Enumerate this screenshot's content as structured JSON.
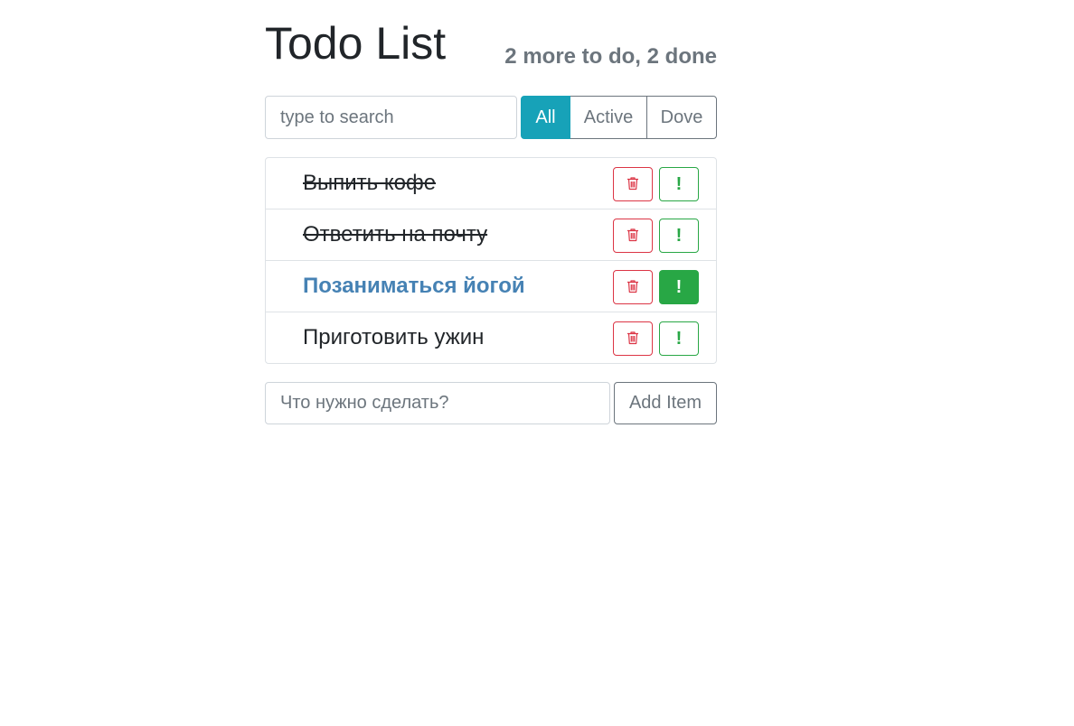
{
  "header": {
    "title": "Todo List",
    "status": "2 more to do, 2 done"
  },
  "search": {
    "placeholder": "type to search",
    "value": ""
  },
  "filters": [
    {
      "label": "All",
      "active": true
    },
    {
      "label": "Active",
      "active": false
    },
    {
      "label": "Dove",
      "active": false
    }
  ],
  "todos": [
    {
      "label": "Выпить кофе",
      "done": true,
      "important": false
    },
    {
      "label": "Ответить на почту",
      "done": true,
      "important": false
    },
    {
      "label": "Позаниматься йогой",
      "done": false,
      "important": true
    },
    {
      "label": "Приготовить ужин",
      "done": false,
      "important": false
    }
  ],
  "item_buttons": {
    "delete_icon": "trash-icon",
    "important_label": "!"
  },
  "add_form": {
    "placeholder": "Что нужно сделать?",
    "value": "",
    "button_label": "Add Item"
  },
  "colors": {
    "filter_active": "#17a2b8",
    "delete": "#dc3545",
    "important": "#28a745",
    "important_text": "#4682b4"
  }
}
